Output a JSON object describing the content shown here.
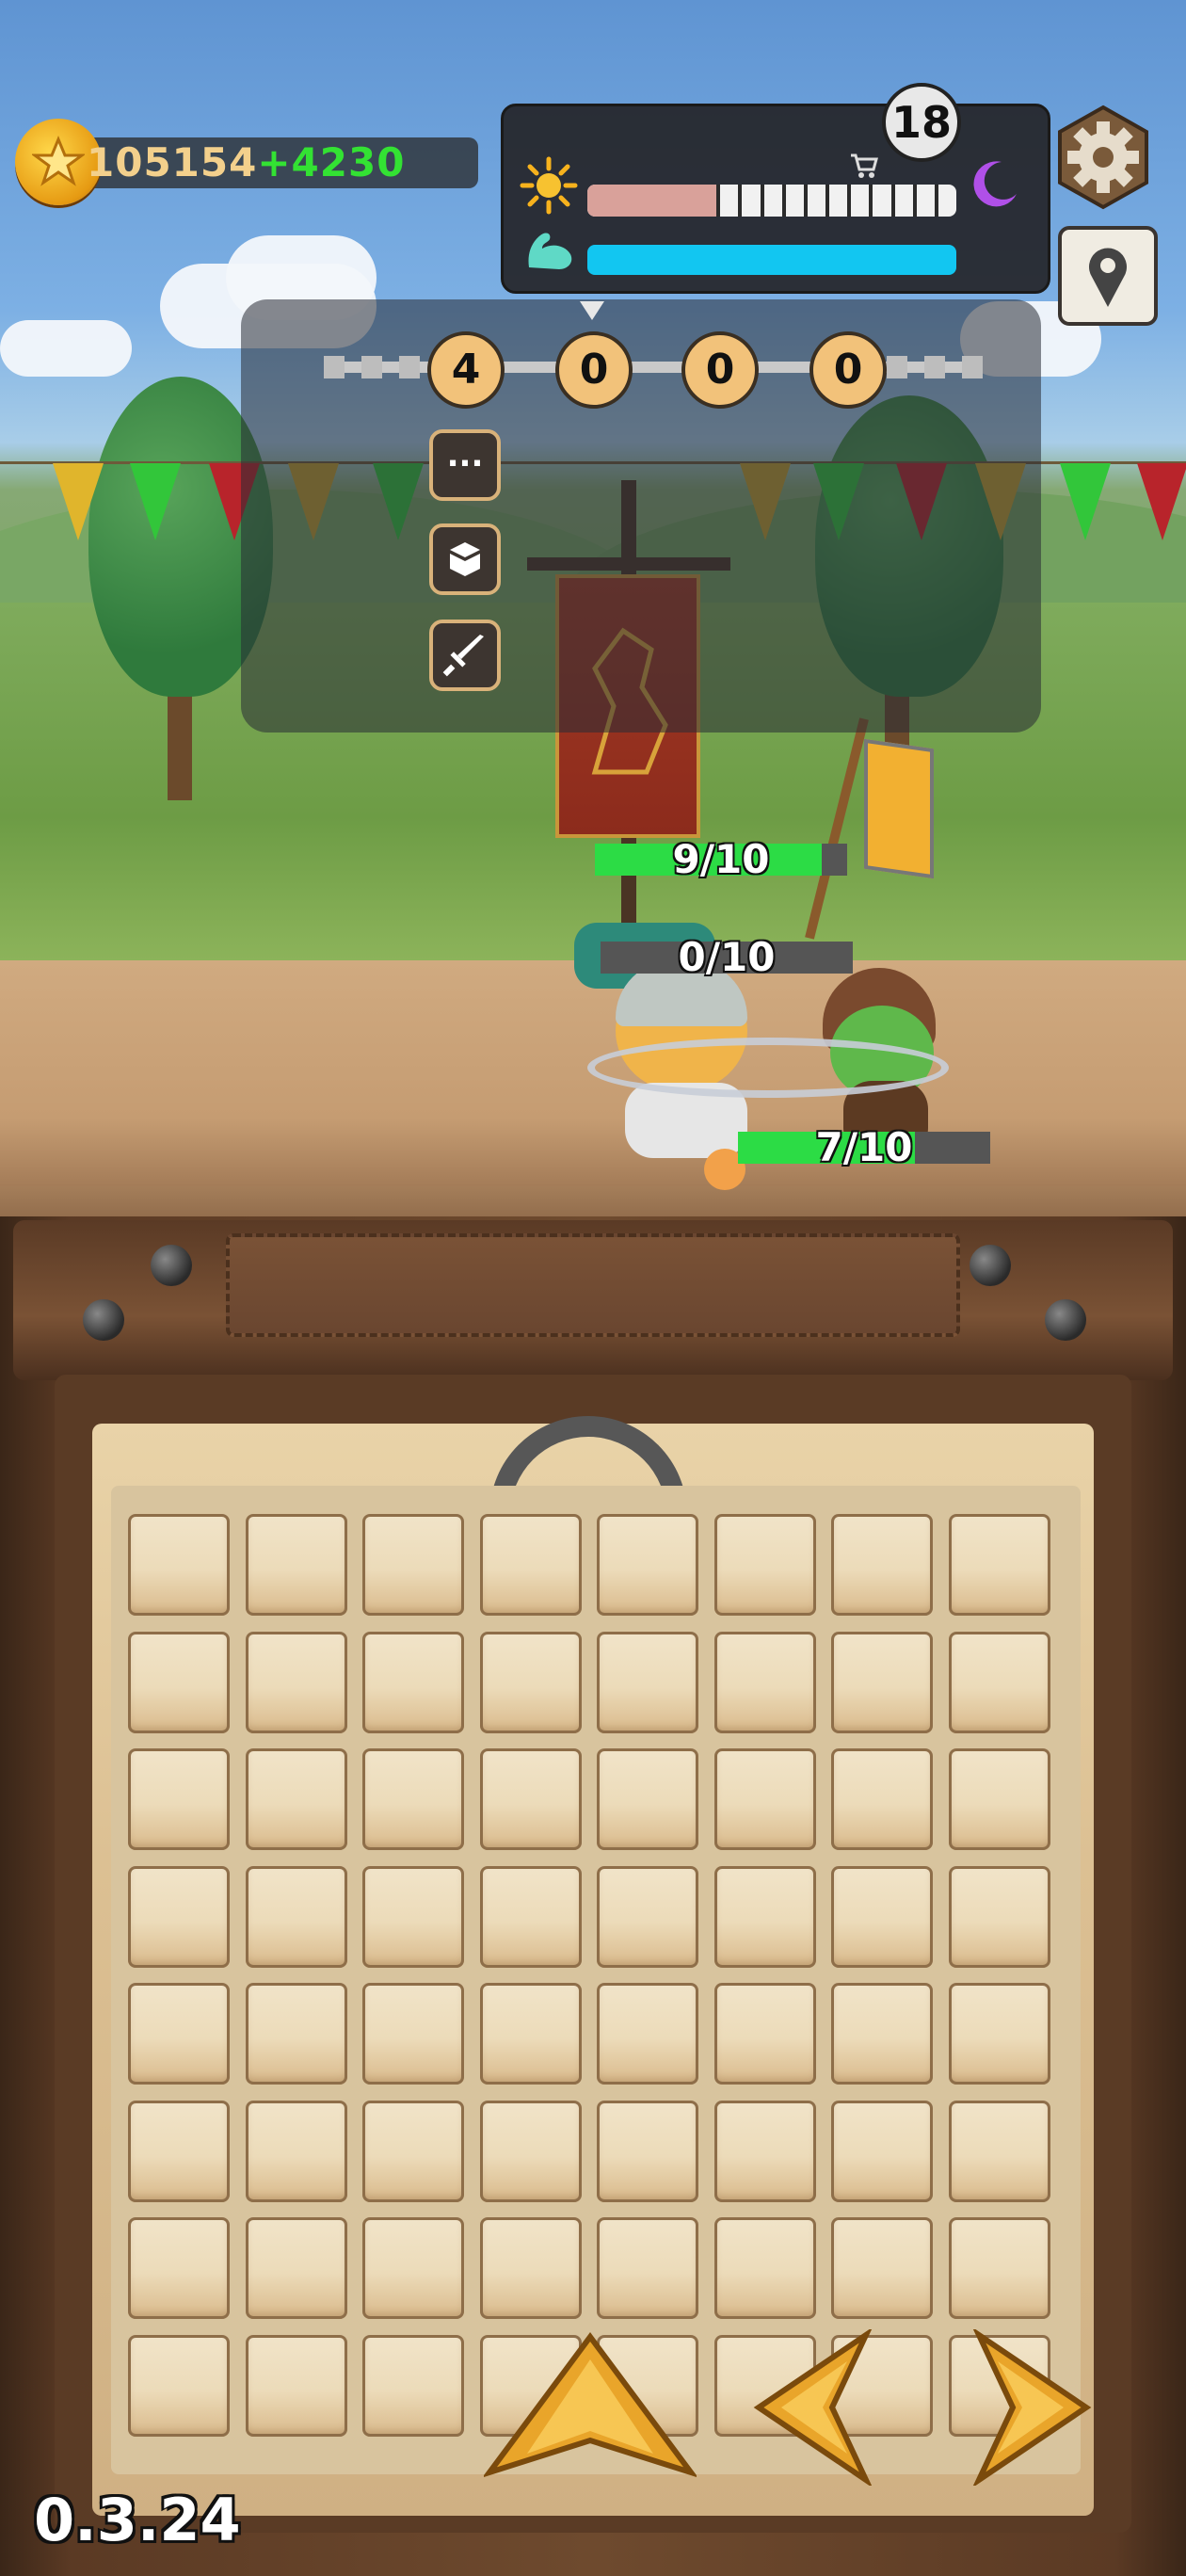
{
  "hud": {
    "coins": "105154",
    "coin_gain": "+4230",
    "day": "18",
    "day_progress": 0.35,
    "energy_progress": 1.0,
    "icons": [
      "coin-icon",
      "sun-icon",
      "cart-icon",
      "moon-icon",
      "muscle-icon",
      "gear-icon",
      "map-pin-icon"
    ]
  },
  "waves": {
    "counts": [
      "4",
      "0",
      "0",
      "0"
    ]
  },
  "side_buttons": [
    {
      "name": "more-button",
      "icon": "ellipsis-icon",
      "label": "..."
    },
    {
      "name": "inventory-button",
      "icon": "box-icon"
    },
    {
      "name": "attack-button",
      "icon": "sword-icon"
    }
  ],
  "battle": {
    "bars": [
      {
        "name": "enemy-hp-bar",
        "text": "9/10",
        "fill": 0.9
      },
      {
        "name": "hero-bar",
        "text": "0/10",
        "fill": 0.0
      },
      {
        "name": "goblin-hp-bar",
        "text": "7/10",
        "fill": 0.7
      }
    ]
  },
  "board": {
    "rows": 8,
    "cols": 8
  },
  "controls": [
    "up-arrow-button",
    "left-arrow-button",
    "right-arrow-button"
  ],
  "version": "0.3.24",
  "colors": {
    "coin_gain": "#33e233",
    "hp_fill": "#2cdc45",
    "energy": "#12c6f1",
    "day_fill": "#d9a19a",
    "tile": "#ecdbb9"
  }
}
